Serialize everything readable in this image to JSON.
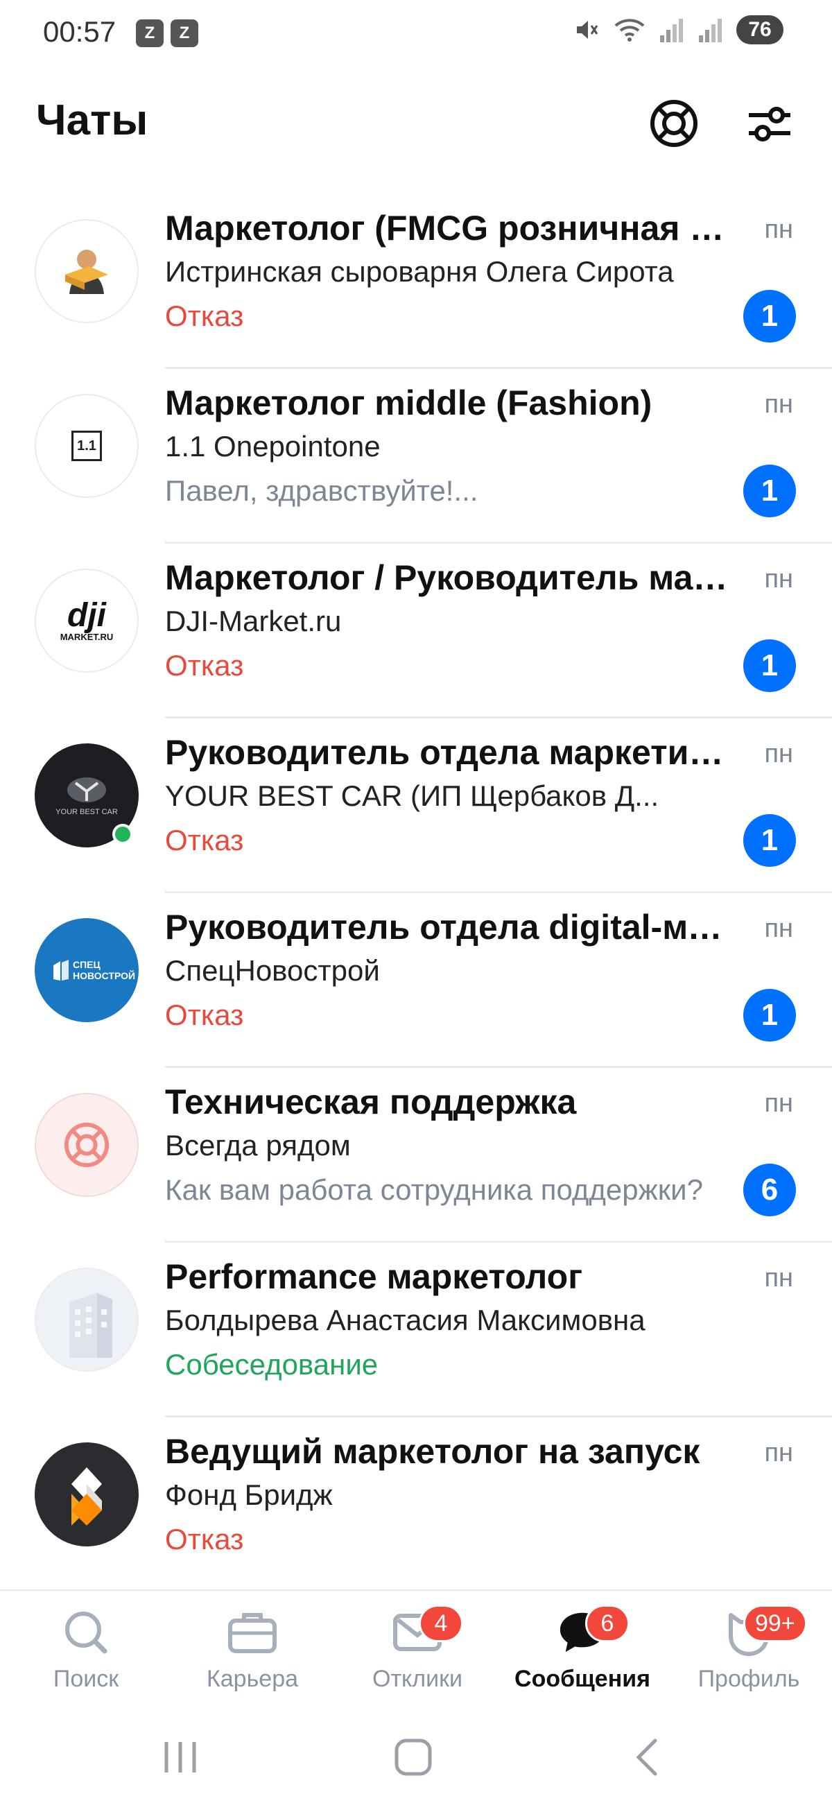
{
  "status_bar": {
    "time": "00:57",
    "app_icon_glyph": "Z",
    "battery": "76"
  },
  "header": {
    "title": "Чаты",
    "support_icon": "lifebuoy-icon",
    "filter_icon": "sliders-icon"
  },
  "chats": [
    {
      "title": "Маркетолог (FMCG розничная сеть)",
      "company": "Истринская сыроварня Олега Сирота",
      "status": "Отказ",
      "status_kind": "reject",
      "date": "пн",
      "unread": "1",
      "avatar": "person-with-cheese",
      "online": false
    },
    {
      "title": "Маркетолог middle (Fashion)",
      "company": "1.1 Onepointone",
      "status": "Павел, здравствуйте!...",
      "status_kind": "preview",
      "date": "пн",
      "unread": "1",
      "avatar": "onepointone-logo",
      "avatar_text": "1.1",
      "online": false
    },
    {
      "title": "Маркетолог / Руководитель маркетинга",
      "company": "DJI-Market.ru",
      "status": "Отказ",
      "status_kind": "reject",
      "date": "пн",
      "unread": "1",
      "avatar": "dji-logo",
      "avatar_text": "dji",
      "avatar_subtext": "MARKET.RU",
      "online": false
    },
    {
      "title": "Руководитель отдела маркетинга",
      "company": "YOUR BEST CAR (ИП Щербаков Д...",
      "status": "Отказ",
      "status_kind": "reject",
      "date": "пн",
      "unread": "1",
      "avatar": "your-best-car-logo",
      "avatar_text": "YOUR BEST CAR",
      "online": true
    },
    {
      "title": "Руководитель отдела digital-маркетинга",
      "company": "СпецНовострой",
      "status": "Отказ",
      "status_kind": "reject",
      "date": "пн",
      "unread": "1",
      "avatar": "specnovostroy-logo",
      "avatar_text": "СПЕЦ НОВОСТРОЙ",
      "online": false
    },
    {
      "title": "Техническая поддержка",
      "company": "Всегда рядом",
      "status": "Как вам работа сотрудника поддержки?",
      "status_kind": "preview",
      "date": "пн",
      "unread": "6",
      "avatar": "lifebuoy-icon",
      "online": false
    },
    {
      "title": "Performance маркетолог",
      "company": "Болдырева Анастасия Максимовна",
      "status": "Собеседование",
      "status_kind": "interview",
      "date": "пн",
      "unread": "",
      "avatar": "building-icon",
      "online": false
    },
    {
      "title": "Ведущий маркетолог на запуск",
      "company": "Фонд Бридж",
      "status": "Отказ",
      "status_kind": "reject",
      "date": "пн",
      "unread": "",
      "avatar": "bridge-fund-logo",
      "online": false
    }
  ],
  "bottom_nav": [
    {
      "label": "Поиск",
      "icon": "search-icon",
      "badge": "",
      "active": false
    },
    {
      "label": "Карьера",
      "icon": "briefcase-icon",
      "badge": "",
      "active": false
    },
    {
      "label": "Отклики",
      "icon": "envelope-icon",
      "badge": "4",
      "active": false
    },
    {
      "label": "Сообщения",
      "icon": "chat-bubble-icon",
      "badge": "6",
      "active": true
    },
    {
      "label": "Профиль",
      "icon": "profile-icon",
      "badge": "99+",
      "active": false
    }
  ],
  "colors": {
    "accent_blue": "#0070ff",
    "reject_red": "#e64a3c",
    "interview_green": "#1fa65a",
    "badge_red": "#f2473b",
    "muted_gray": "#7d8793"
  }
}
